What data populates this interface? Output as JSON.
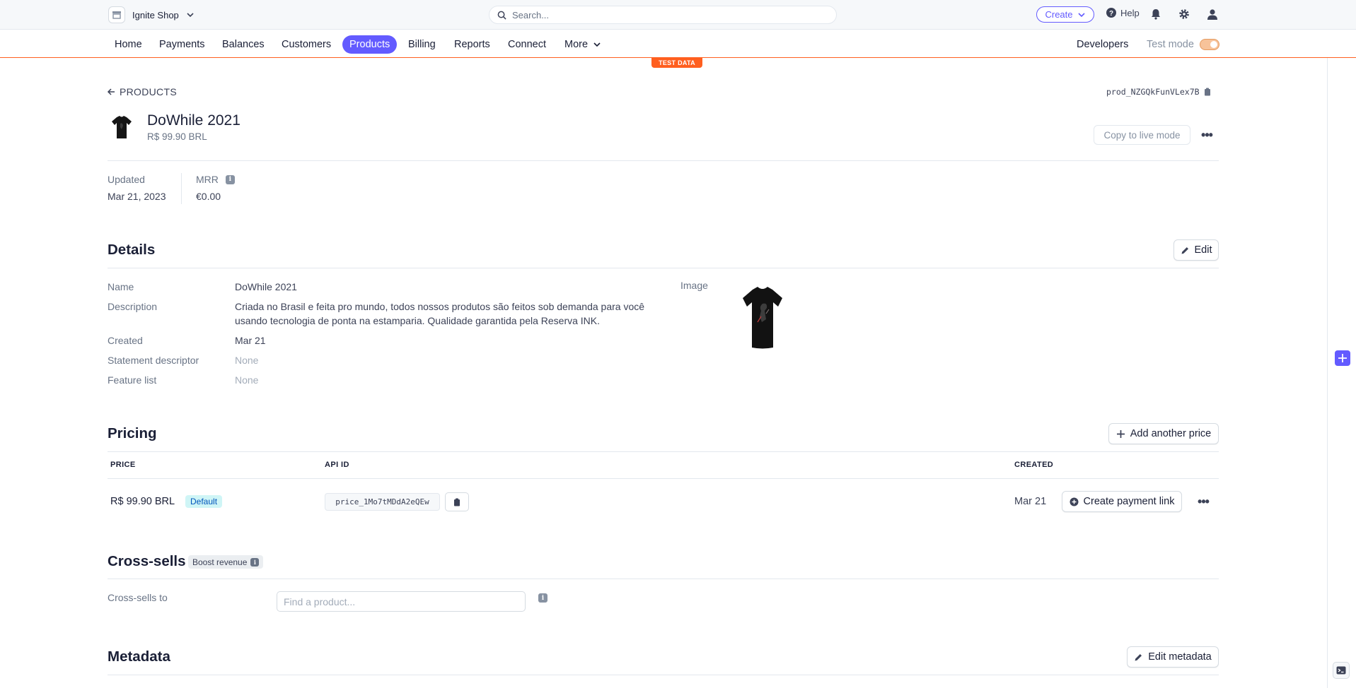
{
  "topbar": {
    "account_name": "Ignite Shop",
    "search_placeholder": "Search...",
    "create_label": "Create",
    "help_label": "Help"
  },
  "nav": {
    "items": [
      "Home",
      "Payments",
      "Balances",
      "Customers",
      "Products",
      "Billing",
      "Reports",
      "Connect",
      "More"
    ],
    "active": "Products",
    "developers_label": "Developers",
    "test_mode_label": "Test mode",
    "test_data_badge": "TEST DATA"
  },
  "product": {
    "back_label": "PRODUCTS",
    "id": "prod_NZGQkFunVLex7B",
    "name": "DoWhile 2021",
    "price": "R$ 99.90 BRL",
    "copy_live_label": "Copy to live mode",
    "image": "black-t-shirt"
  },
  "stats": {
    "updated_label": "Updated",
    "updated_value": "Mar 21, 2023",
    "mrr_label": "MRR",
    "mrr_value": "€0.00"
  },
  "details": {
    "title": "Details",
    "edit_label": "Edit",
    "name_label": "Name",
    "name_value": "DoWhile 2021",
    "description_label": "Description",
    "description_line1": "Criada no Brasil e feita pro mundo, todos nossos produtos são feitos sob demanda para você",
    "description_line2": "usando tecnologia de ponta na estamparia. Qualidade garantida pela Reserva INK.",
    "created_label": "Created",
    "created_value": "Mar 21",
    "statement_label": "Statement descriptor",
    "statement_value": "None",
    "feature_label": "Feature list",
    "feature_value": "None",
    "image_label": "Image"
  },
  "pricing": {
    "title": "Pricing",
    "add_price_label": "Add another price",
    "columns": {
      "price": "PRICE",
      "api_id": "API ID",
      "created": "CREATED"
    },
    "rows": [
      {
        "price": "R$ 99.90 BRL",
        "badge": "Default",
        "api_id": "price_1Mo7tMDdA2eQEw",
        "created": "Mar 21",
        "payment_link_label": "Create payment link"
      }
    ]
  },
  "cross_sells": {
    "title": "Cross-sells",
    "badge": "Boost revenue",
    "label": "Cross-sells to",
    "placeholder": "Find a product..."
  },
  "metadata": {
    "title": "Metadata",
    "edit_label": "Edit metadata"
  },
  "colors": {
    "accent": "#635bff",
    "test_mode": "#ff5f1f",
    "default_badge_bg": "#cff5f6",
    "default_badge_text": "#0055bc"
  }
}
